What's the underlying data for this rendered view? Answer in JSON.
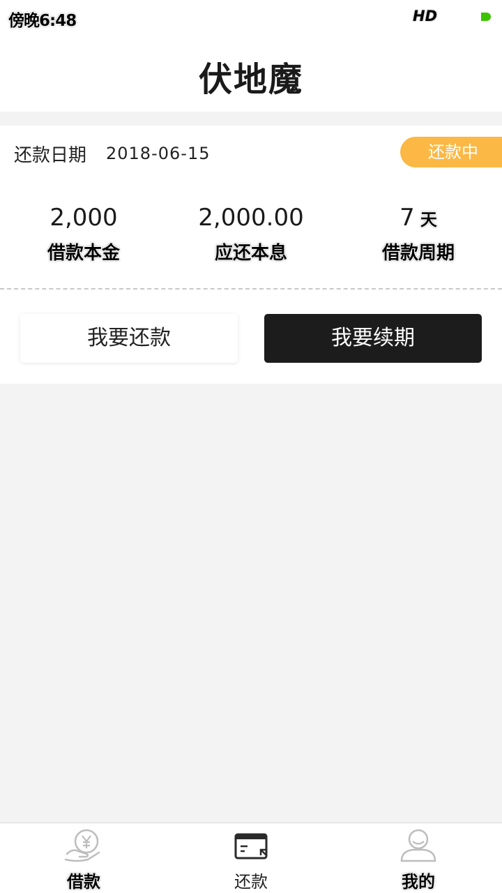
{
  "status_bar": {
    "time": "傍晚6:48",
    "network": "HD"
  },
  "header": {
    "title": "伏地魔"
  },
  "loan": {
    "due_label": "还款日期",
    "due_date": "2018-06-15",
    "status": "还款中",
    "principal": {
      "value": "2,000",
      "label": "借款本金"
    },
    "payable": {
      "value": "2,000.00",
      "label": "应还本息"
    },
    "period": {
      "value": "7",
      "unit": "天",
      "label": "借款周期"
    }
  },
  "actions": {
    "repay": "我要还款",
    "renew": "我要续期"
  },
  "tabs": [
    {
      "label": "借款",
      "icon": "loan-icon"
    },
    {
      "label": "还款",
      "icon": "repay-card-icon"
    },
    {
      "label": "我的",
      "icon": "user-icon"
    }
  ],
  "colors": {
    "accent": "#fcb844",
    "dark": "#1c1c1c",
    "battery": "#3cc400"
  }
}
